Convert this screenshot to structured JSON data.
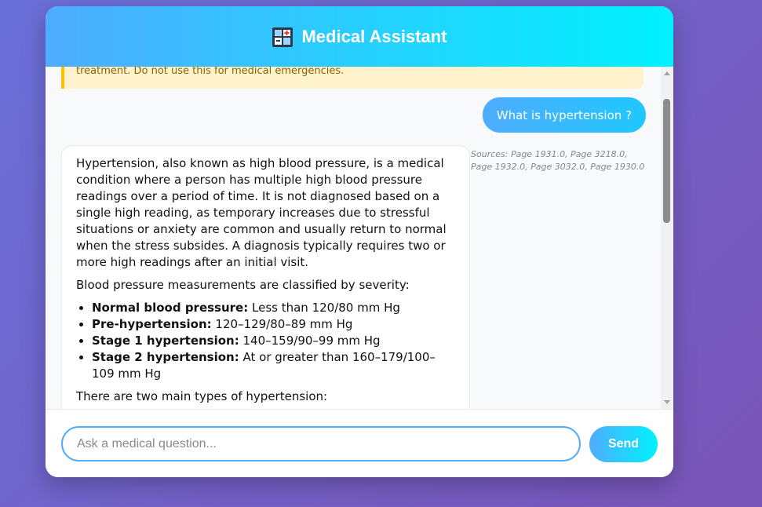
{
  "header": {
    "title": "Medical Assistant",
    "logo_icon": "hospital-icon"
  },
  "disclaimer": {
    "visible_text": "treatment. Do not use this for medical emergencies."
  },
  "messages": {
    "user_question": "What is hypertension ?",
    "sources": "Sources: Page 1931.0, Page 3218.0, Page 1932.0, Page 3032.0, Page 1930.0",
    "bot_answer": {
      "paragraph1": "Hypertension, also known as high blood pressure, is a medical condition where a person has multiple high blood pressure readings over a period of time. It is not diagnosed based on a single high reading, as temporary increases due to stressful situations or anxiety are common and usually return to normal when the stress subsides. A diagnosis typically requires two or more high readings after an initial visit.",
      "paragraph2": "Blood pressure measurements are classified by severity:",
      "list": [
        {
          "label": "Normal blood pressure:",
          "value": " Less than 120/80 mm Hg"
        },
        {
          "label": "Pre-hypertension:",
          "value": " 120–129/80–89 mm Hg"
        },
        {
          "label": "Stage 1 hypertension:",
          "value": " 140–159/90–99 mm Hg"
        },
        {
          "label": "Stage 2 hypertension:",
          "value": " At or greater than 160–179/100–109 mm Hg"
        }
      ],
      "paragraph3": "There are two main types of hypertension:"
    }
  },
  "input": {
    "placeholder": "Ask a medical question...",
    "value": ""
  },
  "send_button": {
    "label": "Send"
  },
  "colors": {
    "accent_start": "#4facfe",
    "accent_end": "#00f2fe",
    "disclaimer_bg": "#fff3cd",
    "disclaimer_border": "#ffc107"
  }
}
